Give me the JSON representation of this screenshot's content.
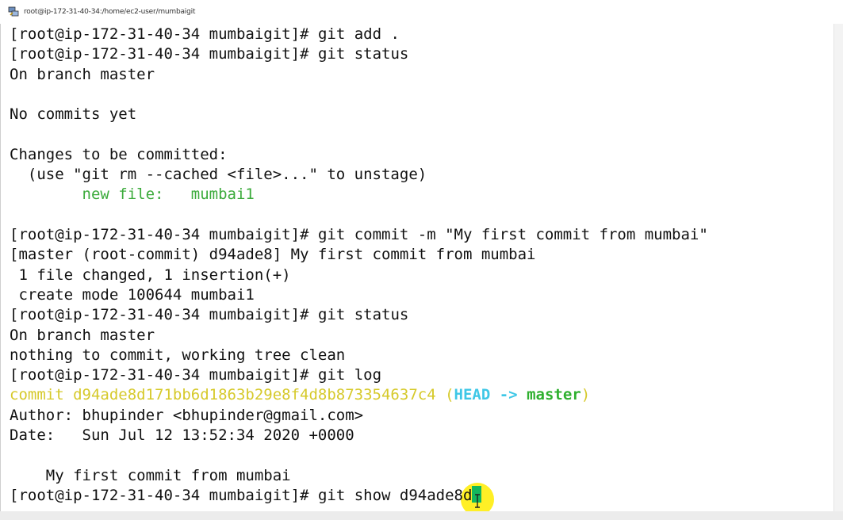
{
  "window": {
    "title": "root@ip-172-31-40-34:/home/ec2-user/mumbaigit"
  },
  "terminal": {
    "prompt": "[root@ip-172-31-40-34 mumbaigit]#",
    "lines": [
      {
        "type": "prompt",
        "command": " git add ."
      },
      {
        "type": "prompt",
        "command": " git status"
      },
      {
        "type": "output",
        "text": "On branch master"
      },
      {
        "type": "output",
        "text": ""
      },
      {
        "type": "output",
        "text": "No commits yet"
      },
      {
        "type": "output",
        "text": ""
      },
      {
        "type": "output",
        "text": "Changes to be committed:"
      },
      {
        "type": "output",
        "text": "  (use \"git rm --cached <file>...\" to unstage)"
      },
      {
        "type": "newfile",
        "label": "new file:",
        "file": "mumbai1"
      },
      {
        "type": "output",
        "text": ""
      },
      {
        "type": "prompt",
        "command": " git commit -m \"My first commit from mumbai\""
      },
      {
        "type": "output",
        "text": "[master (root-commit) d94ade8] My first commit from mumbai"
      },
      {
        "type": "output",
        "text": " 1 file changed, 1 insertion(+)"
      },
      {
        "type": "output",
        "text": " create mode 100644 mumbai1"
      },
      {
        "type": "prompt",
        "command": " git status"
      },
      {
        "type": "output",
        "text": "On branch master"
      },
      {
        "type": "output",
        "text": "nothing to commit, working tree clean"
      },
      {
        "type": "prompt",
        "command": " git log"
      },
      {
        "type": "commit",
        "hash_text": "commit d94ade8d171bb6d1863b29e8f4d8b873354637c4",
        "open": "(",
        "head": "HEAD -> ",
        "branch": "master",
        "close": ")"
      },
      {
        "type": "output",
        "text": "Author: bhupinder <bhupinder@gmail.com>"
      },
      {
        "type": "output",
        "text": "Date:   Sun Jul 12 13:52:34 2020 +0000"
      },
      {
        "type": "output",
        "text": ""
      },
      {
        "type": "output",
        "text": "    My first commit from mumbai"
      },
      {
        "type": "current",
        "command": " git show d94ade8d"
      }
    ]
  },
  "colors": {
    "new_file": "#3cab3c",
    "commit_hash": "#d6c92a",
    "head": "#3ec7e6",
    "branch": "#2fb02f",
    "cursor": "#12b75d",
    "cursor_highlight": "#ffec00"
  },
  "icons": {
    "window_icon": "putty-icon",
    "pointer": "text-cursor-icon"
  }
}
